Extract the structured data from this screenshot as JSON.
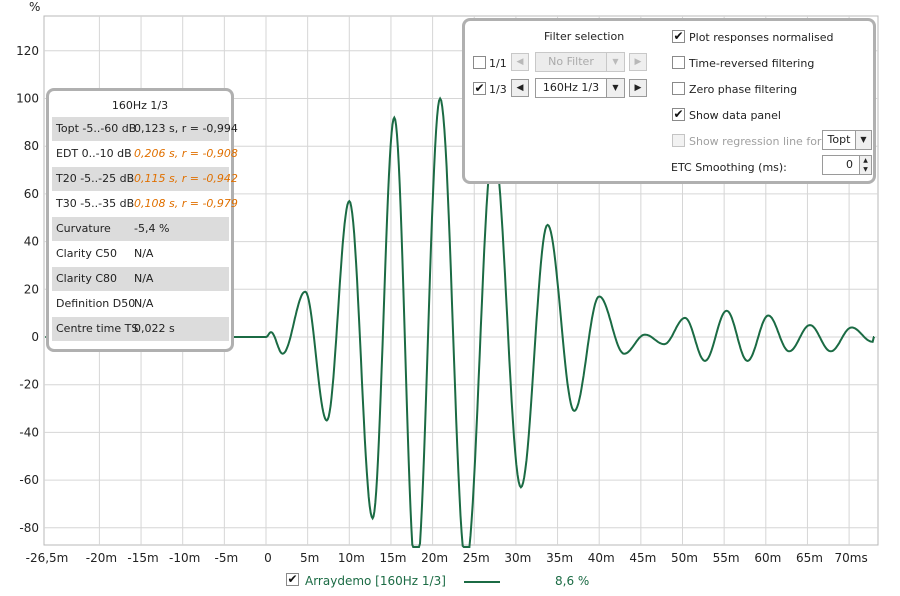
{
  "chart_data": {
    "type": "line",
    "ylabel": "%",
    "xlim": [
      -26.5,
      73
    ],
    "ylim": [
      -88,
      134
    ],
    "grid": true,
    "y_ticks": [
      "120",
      "100",
      "80",
      "60",
      "40",
      "20",
      "0",
      "-20",
      "-40",
      "-60",
      "-80"
    ],
    "x_ticks": [
      "-26,5m",
      "-20m",
      "-15m",
      "-10m",
      "-5m",
      "0",
      "5m",
      "10m",
      "15m",
      "20m",
      "25m",
      "30m",
      "35m",
      "40m",
      "45m",
      "50m",
      "55m",
      "60m",
      "65m",
      "70ms"
    ],
    "series": [
      {
        "name": "Arraydemo [160Hz 1/3]",
        "color": "#1b6b44",
        "x": [
          -26.5,
          0,
          0.6,
          2.0,
          4.7,
          7.3,
          10.0,
          12.8,
          15.4,
          18.0,
          20.9,
          24.0,
          27.3,
          30.6,
          33.8,
          37.0,
          40.0,
          43.0,
          45.5,
          47.8,
          50.3,
          52.7,
          55.3,
          57.8,
          60.3,
          62.8,
          65.3,
          67.8,
          70.3,
          72.8,
          73
        ],
        "y": [
          0,
          0,
          2,
          -7,
          19,
          -35,
          57,
          -76,
          92,
          -100,
          100,
          -95,
          80,
          -63,
          47,
          -31,
          17,
          -7,
          1,
          -3,
          8,
          -10,
          11,
          -10,
          9,
          -6,
          5,
          -6,
          4,
          -2,
          0
        ]
      }
    ]
  },
  "data_panel": {
    "title": "160Hz 1/3",
    "rows": [
      {
        "label": "Topt -5..-60 dB",
        "value": "0,123 s,  r = -0,994"
      },
      {
        "label": "EDT  0..-10 dB",
        "value": "0,206 s, r = -0,908"
      },
      {
        "label": "T20 -5..-25 dB",
        "value": "0,115 s, r = -0,942"
      },
      {
        "label": "T30 -5..-35 dB",
        "value": "0,108 s, r = -0,979"
      },
      {
        "label": "Curvature",
        "value": "-5,4 %"
      },
      {
        "label": "Clarity C50",
        "value": "N/A"
      },
      {
        "label": "Clarity C80",
        "value": "N/A"
      },
      {
        "label": "Definition D50",
        "value": "N/A"
      },
      {
        "label": "Centre time TS",
        "value": "0,022 s"
      }
    ],
    "warning_color": "#e07000"
  },
  "filter_panel": {
    "title": "Filter selection",
    "octave_label": "1/1",
    "octave_checked": false,
    "octave_value": "No Filter",
    "third_label": "1/3",
    "third_checked": true,
    "third_value": "160Hz 1/3",
    "options": [
      {
        "label": "Plot responses normalised",
        "checked": true
      },
      {
        "label": "Time-reversed filtering",
        "checked": false
      },
      {
        "label": "Zero phase filtering",
        "checked": false
      },
      {
        "label": "Show data panel",
        "checked": true
      },
      {
        "label": "Show regression line for:",
        "checked": false
      }
    ],
    "regression_value": "Topt",
    "etc_label": "ETC Smoothing (ms):",
    "etc_value": "0"
  },
  "legend": {
    "checked": true,
    "name": "Arraydemo [160Hz 1/3]",
    "value": "8,6 %",
    "color": "#1b6b44"
  }
}
